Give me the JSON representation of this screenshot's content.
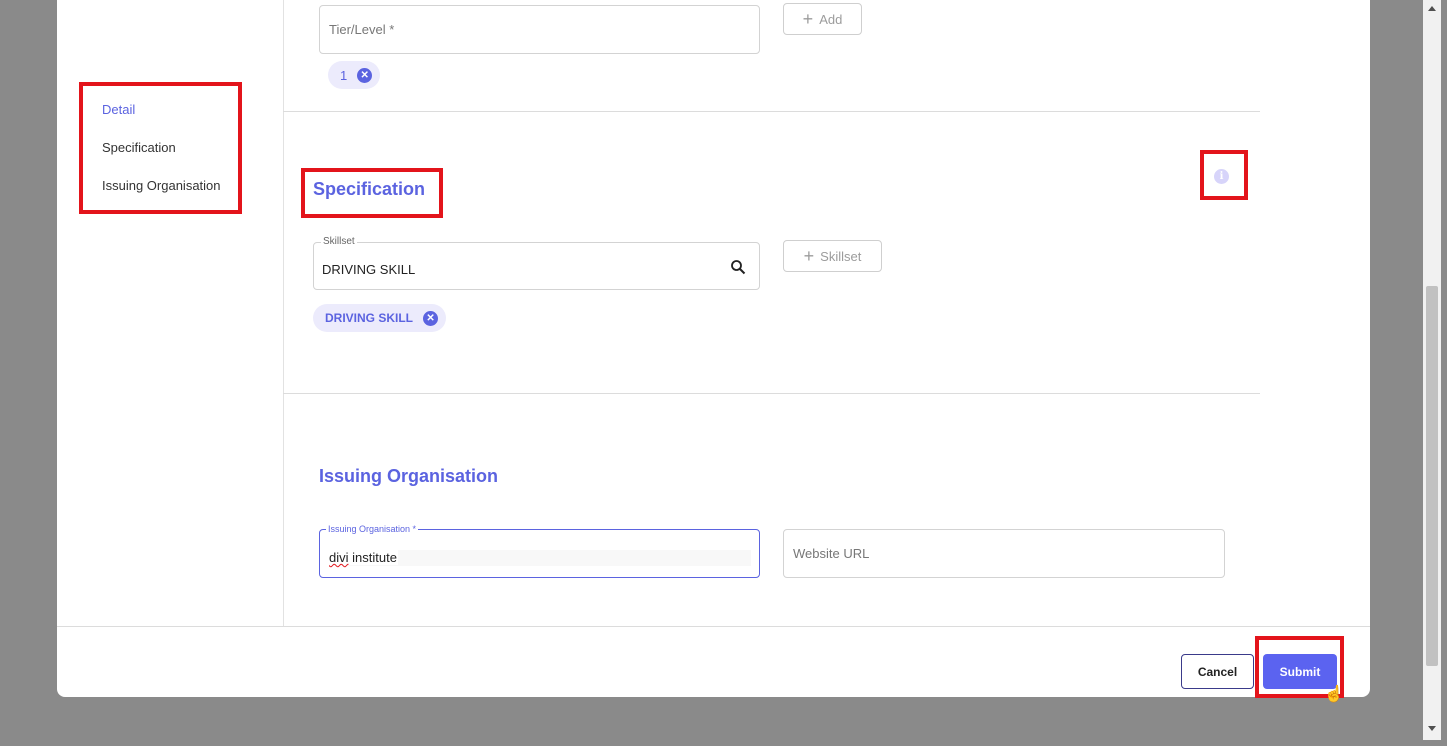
{
  "sidenav": {
    "items": [
      {
        "label": "Detail",
        "active": true
      },
      {
        "label": "Specification",
        "active": false
      },
      {
        "label": "Issuing Organisation",
        "active": false
      }
    ]
  },
  "detail": {
    "tier_placeholder": "Tier/Level *",
    "add_label": "Add",
    "tier_chip": "1"
  },
  "specification": {
    "title": "Specification",
    "skillset_label": "Skillset",
    "skillset_value": "DRIVING SKILL",
    "add_skillset_label": "Skillset",
    "skill_chip": "DRIVING SKILL",
    "info_icon_glyph": "i"
  },
  "issuing_org": {
    "title": "Issuing Organisation",
    "org_label": "Issuing Organisation *",
    "org_value_word1": "divi",
    "org_value_word2": " institute",
    "website_placeholder": "Website URL"
  },
  "footer": {
    "cancel_label": "Cancel",
    "submit_label": "Submit"
  },
  "colors": {
    "accent": "#5b63e0",
    "highlight": "#e3141b",
    "chip_bg": "#ecebfc"
  }
}
